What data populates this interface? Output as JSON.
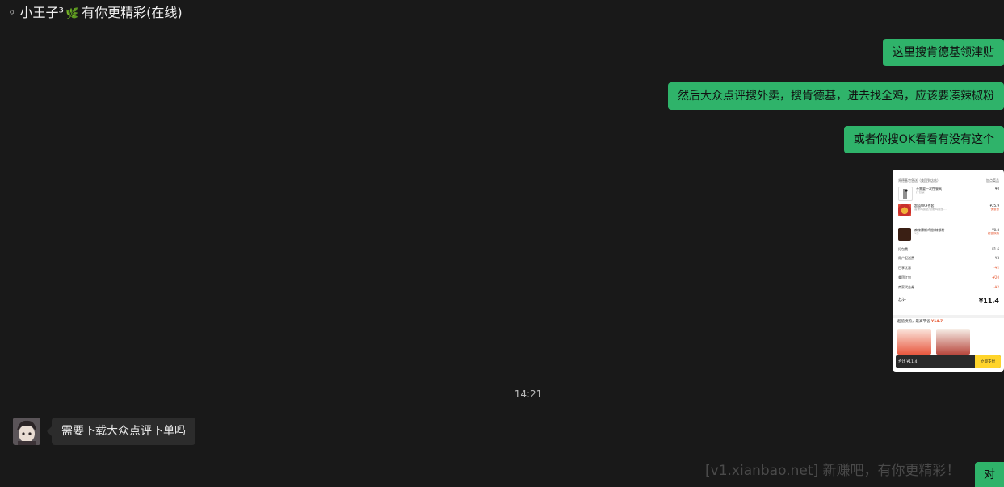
{
  "header": {
    "name_prefix": "◦ 小王子³",
    "leaf_icon": "🌿",
    "name_suffix": "有你更精彩(在线)"
  },
  "messages": {
    "out_1": "这里搜肯德基领津贴",
    "out_2": "然后大众点评搜外卖，搜肯德基，进去找全鸡，应该要凑辣椒粉",
    "out_3": "或者你搜OK看看有没有这个",
    "timestamp": "14:21",
    "in_1": "需要下载大众点评下单吗",
    "partial_out": "对"
  },
  "order_card": {
    "shop": "肯德基宅急送（美团到店店）",
    "shop_right": "加点菜品",
    "items": [
      {
        "name": "不需要一次性餐具",
        "sub": "打包袋",
        "price": "¥0",
        "note": ""
      },
      {
        "name": "超值OK9件套",
        "sub": "香辣鸡腿堡/劲脆鸡腿堡…",
        "price": "¥25.9",
        "note": "优惠价"
      },
      {
        "name": "麻辣藤椒鸡翅/辣椒粉",
        "sub": "1份",
        "price": "¥0.8",
        "note": "超值换购"
      }
    ],
    "lines": [
      {
        "label": "打包费",
        "value": "¥1.6",
        "neg": false
      },
      {
        "label": "用户配送费",
        "value": "¥3",
        "neg": false
      },
      {
        "label": "已享优惠",
        "value": "-¥2",
        "neg": true
      },
      {
        "label": "美团红包",
        "value": "-¥20",
        "neg": true
      },
      {
        "label": "商家代金券",
        "value": "-¥2",
        "neg": true
      }
    ],
    "total_label": "总计",
    "total_value": "¥11.4",
    "promo_prefix": "超值换购，最高节省",
    "promo_value": "¥14.7",
    "pay_label": "合计 ¥11.4",
    "pay_button": "立即支付"
  },
  "watermark": "[v1.xianbao.net] 新赚吧，有你更精彩！",
  "colors": {
    "background": "#191919",
    "outgoing_bubble": "#2fb36a",
    "incoming_bubble": "#2c2c2c",
    "accent_red": "#e5532c",
    "pay_yellow": "#ffd42a"
  }
}
